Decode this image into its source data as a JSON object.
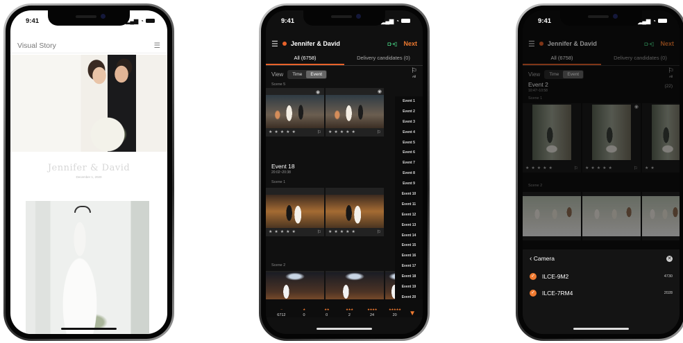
{
  "phone1": {
    "time": "9:41",
    "app_title": "Visual Story",
    "couple_names": "Jennifer & David",
    "date_line": "December 1, 2020"
  },
  "phone2": {
    "time": "9:41",
    "title": "Jennifer & David",
    "next_label": "Next",
    "tabs": [
      {
        "label": "All (6758)",
        "active": true
      },
      {
        "label": "Delivery candidates (0)",
        "active": false
      }
    ],
    "view_label": "View",
    "view_options": [
      "Time",
      "Event"
    ],
    "filter_all_label": "All",
    "scene_labels": [
      "Scene 5",
      "Scene 1",
      "Scene 2"
    ],
    "event_title": "Event 18",
    "event_time": "20:02~20:38",
    "event_index": [
      "Event 1",
      "Event 2",
      "Event 3",
      "Event 4",
      "Event 5",
      "Event 6",
      "Event 7",
      "Event 8",
      "Event 9",
      "Event 10",
      "Event 11",
      "Event 12",
      "Event 13",
      "Event 14",
      "Event 15",
      "Event 16",
      "Event 17",
      "Event 18",
      "Event 19",
      "Event 20"
    ],
    "ratings": [
      {
        "stars": "–",
        "count": "6712"
      },
      {
        "stars": "★",
        "count": "0"
      },
      {
        "stars": "★★",
        "count": "0"
      },
      {
        "stars": "★★★",
        "count": "2"
      },
      {
        "stars": "★★★★",
        "count": "24"
      },
      {
        "stars": "★★★★★",
        "count": "20"
      }
    ]
  },
  "phone3": {
    "time": "9:41",
    "title": "Jennifer & David",
    "next_label": "Next",
    "tabs": [
      {
        "label": "All (6758)",
        "active": true
      },
      {
        "label": "Delivery candidates (0)",
        "active": false
      }
    ],
    "view_label": "View",
    "view_options": [
      "Time",
      "Event"
    ],
    "filter_all_label": "All",
    "event_title": "Event 2",
    "event_time": "10:47~10:58",
    "event_count": "(22)",
    "scene_labels": [
      "Scene 1",
      "Scene 2"
    ],
    "sheet_title": "Camera",
    "cameras": [
      {
        "name": "ILCE-9M2",
        "count": "4730"
      },
      {
        "name": "ILCE-7RM4",
        "count": "2028"
      }
    ]
  },
  "colors": {
    "accent": "#ef7a30",
    "dark_bg": "#101010"
  }
}
